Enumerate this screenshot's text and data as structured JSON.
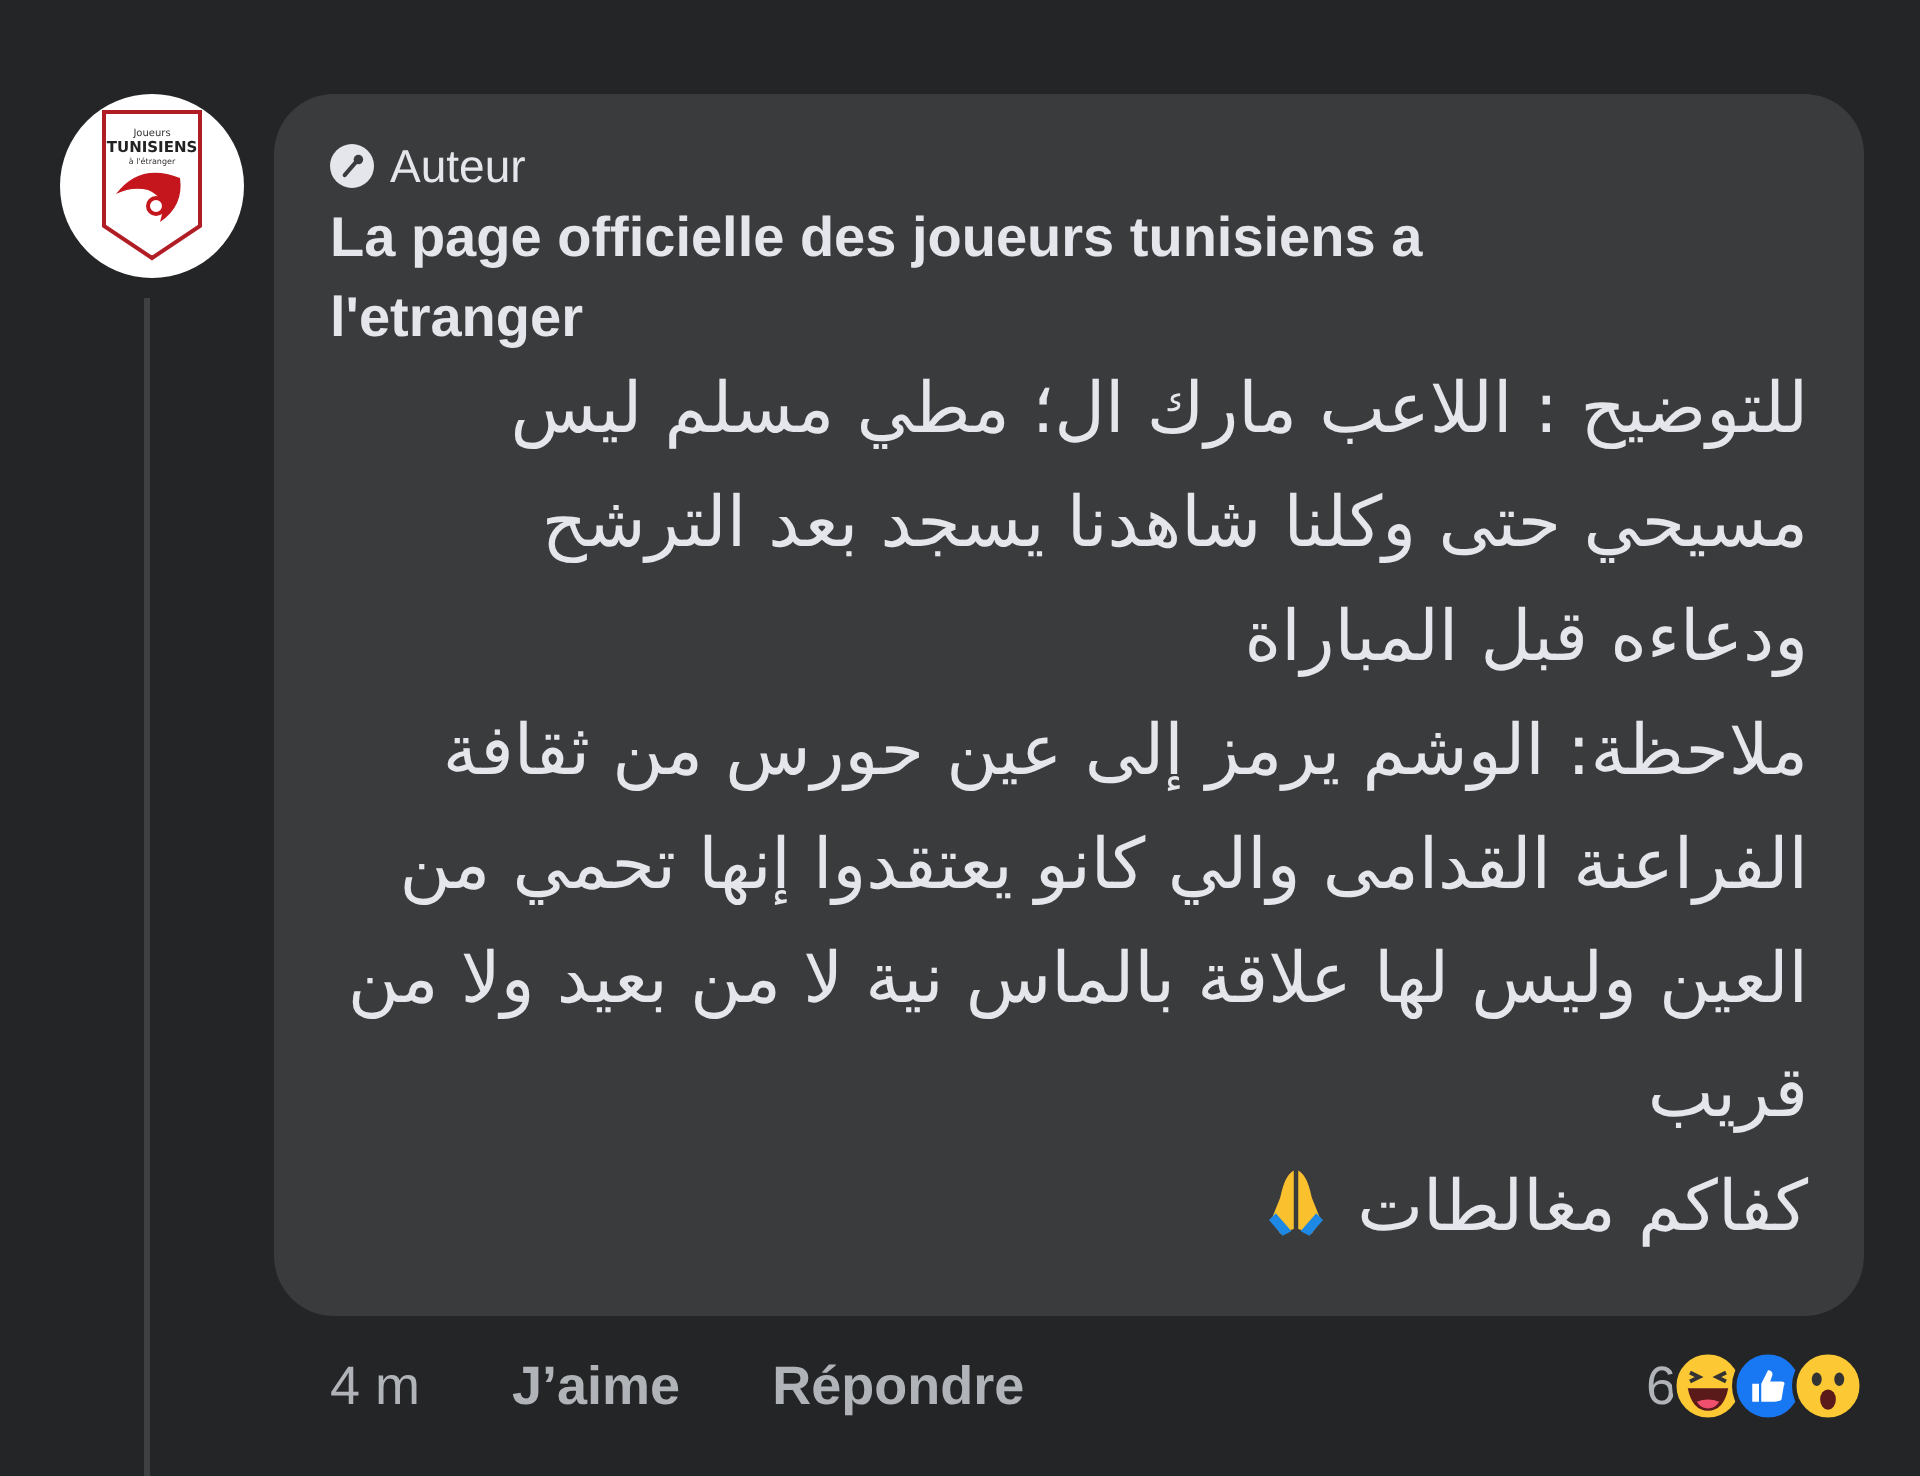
{
  "avatar": {
    "lines": [
      "Joueurs",
      "TUNISIENS",
      "à l'étranger"
    ]
  },
  "comment": {
    "badge": "Auteur",
    "author": "La page officielle des joueurs tunisiens a l'etranger",
    "paragraphs": [
      {
        "text": "للتوضيح : اللاعب مارك ال؛ مطي مسلم ليس مسيحي حتى وكلنا شاهدنا يسجد بعد الترشح ودعاءه قبل المباراة",
        "emoji": false
      },
      {
        "text": "ملاحظة: الوشم يرمز إلى عين حورس من ثقافة الفراعنة القدامى والي كانو يعتقدوا إنها تحمي من العين وليس لها علاقة بالماس نية لا من بعيد ولا من قريب",
        "emoji": false
      },
      {
        "text": "كفاكم مغالطات",
        "emoji": true
      }
    ]
  },
  "footer": {
    "time": "4 m",
    "like": "J’aime",
    "reply": "Répondre",
    "reaction_count": "6",
    "reactions": [
      {
        "kind": "haha"
      },
      {
        "kind": "like"
      },
      {
        "kind": "wow"
      }
    ]
  }
}
